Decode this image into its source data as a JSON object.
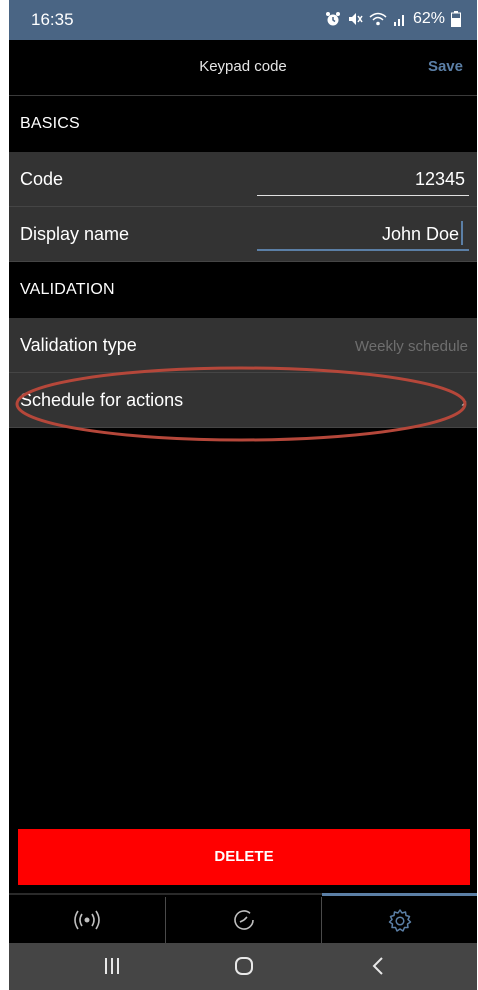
{
  "status_bar": {
    "time": "16:35",
    "battery": "62%"
  },
  "header": {
    "title": "Keypad code",
    "save_label": "Save"
  },
  "sections": {
    "basics": {
      "title": "BASICS",
      "code_label": "Code",
      "code_value": "12345",
      "display_name_label": "Display name",
      "display_name_value": "John Doe"
    },
    "validation": {
      "title": "VALIDATION",
      "validation_type_label": "Validation type",
      "validation_type_value": "Weekly schedule",
      "schedule_label": "Schedule for actions"
    }
  },
  "delete_label": "DELETE",
  "tabs": [
    {
      "icon": "radio-signal-icon",
      "selected": false
    },
    {
      "icon": "history-clock-icon",
      "selected": false
    },
    {
      "icon": "gear-icon",
      "selected": true
    }
  ],
  "android_nav": [
    "recent-apps-icon",
    "home-icon",
    "back-icon"
  ],
  "colors": {
    "status_bar": "#4a6584",
    "accent": "#5b7fa6",
    "row_bg": "#333333",
    "delete_bg": "#ff0000",
    "annotation": "#b5473a"
  }
}
